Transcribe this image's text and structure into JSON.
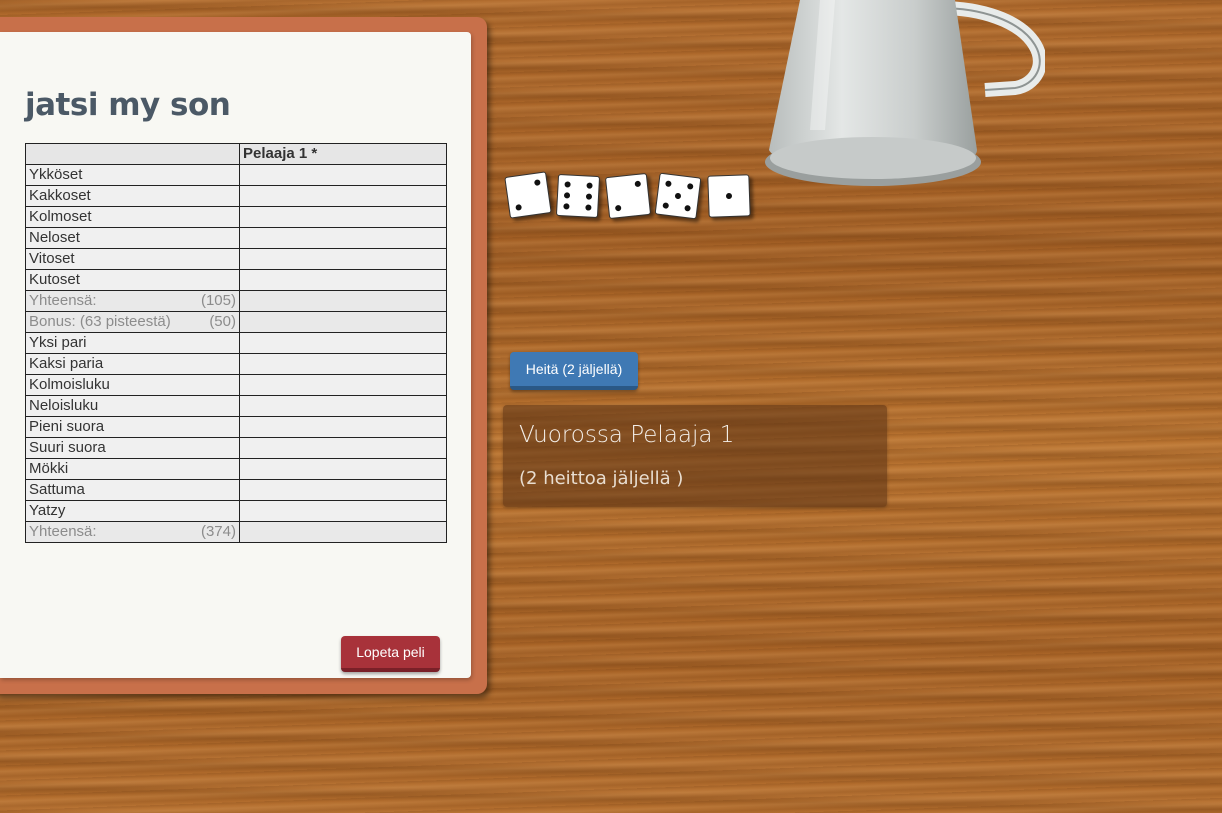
{
  "game": {
    "title": "jatsi my son"
  },
  "scorecard": {
    "player_header": "Pelaaja 1 *",
    "rows": [
      {
        "label": "Ykköset",
        "max": "",
        "score": ""
      },
      {
        "label": "Kakkoset",
        "max": "",
        "score": ""
      },
      {
        "label": "Kolmoset",
        "max": "",
        "score": ""
      },
      {
        "label": "Neloset",
        "max": "",
        "score": ""
      },
      {
        "label": "Vitoset",
        "max": "",
        "score": ""
      },
      {
        "label": "Kutoset",
        "max": "",
        "score": ""
      },
      {
        "label": "Yhteensä:",
        "max": "(105)",
        "score": ""
      },
      {
        "label": "Bonus: (63 pisteestä)",
        "max": "(50)",
        "score": ""
      },
      {
        "label": "Yksi pari",
        "max": "",
        "score": ""
      },
      {
        "label": "Kaksi paria",
        "max": "",
        "score": ""
      },
      {
        "label": "Kolmoisluku",
        "max": "",
        "score": ""
      },
      {
        "label": "Neloisluku",
        "max": "",
        "score": ""
      },
      {
        "label": "Pieni suora",
        "max": "",
        "score": ""
      },
      {
        "label": "Suuri suora",
        "max": "",
        "score": ""
      },
      {
        "label": "Mökki",
        "max": "",
        "score": ""
      },
      {
        "label": "Sattuma",
        "max": "",
        "score": ""
      },
      {
        "label": "Yatzy",
        "max": "",
        "score": ""
      },
      {
        "label": "Yhteensä:",
        "max": "(374)",
        "score": ""
      }
    ]
  },
  "buttons": {
    "quit_label": "Lopeta peli",
    "roll_label": "Heitä (2 jäljellä)"
  },
  "dice": [
    2,
    6,
    2,
    5,
    1
  ],
  "turn": {
    "title": "Vuorossa Pelaaja 1",
    "subtitle": "(2 heittoa jäljellä )"
  },
  "colors": {
    "table_wood": "#b06a2c",
    "frame": "#c8704a",
    "roll_button": "#3f79b4",
    "quit_button": "#a8323a"
  }
}
